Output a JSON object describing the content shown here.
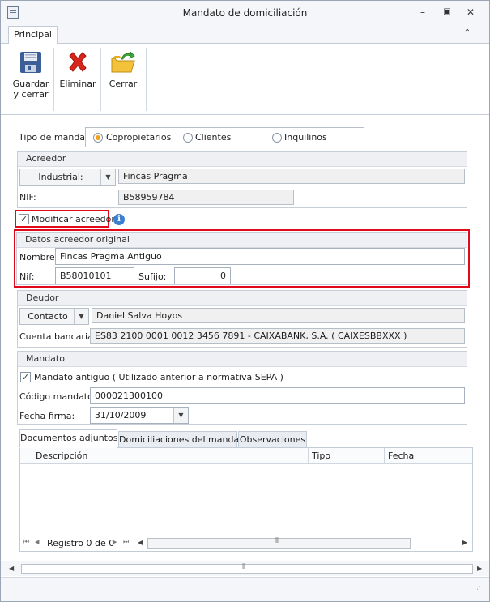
{
  "window": {
    "title": "Mandato de domiciliación",
    "min_glyph": "–",
    "max_glyph": "▣",
    "close_glyph": "✕"
  },
  "ribbon": {
    "tab": "Principal",
    "collapse_glyph": "⌃",
    "buttons": {
      "save_line1": "Guardar",
      "save_line2": "y cerrar",
      "delete": "Eliminar",
      "close": "Cerrar"
    }
  },
  "tipo_mandato": {
    "label": "Tipo de mandato:",
    "options": [
      "Copropietarios",
      "Clientes",
      "Inquilinos"
    ],
    "selected": "Copropietarios"
  },
  "acreedor": {
    "title": "Acreedor",
    "type": "Industrial:",
    "name": "Fincas Pragma",
    "nif_label": "NIF:",
    "nif": "B58959784"
  },
  "modificar": {
    "label": "Modificar acreedor",
    "checked": true,
    "info_glyph": "i"
  },
  "original": {
    "title": "Datos acreedor original",
    "nombre_label": "Nombre:",
    "nombre": "Fincas Pragma Antiguo",
    "nif_label": "Nif:",
    "nif": "B58010101",
    "sufijo_label": "Sufijo:",
    "sufijo": "0"
  },
  "deudor": {
    "title": "Deudor",
    "type": "Contacto",
    "name": "Daniel Salva Hoyos",
    "cuenta_label": "Cuenta bancaria:",
    "cuenta": "ES83 2100 0001 0012 3456 7891 - CAIXABANK, S.A. ( CAIXESBBXXX )"
  },
  "mandato": {
    "title": "Mandato",
    "antiguo_label": "Mandato antiguo ( Utilizado anterior a normativa SEPA )",
    "antiguo_checked": true,
    "codigo_label": "Código mandato:",
    "codigo": "000021300100",
    "fecha_label": "Fecha firma:",
    "fecha": "31/10/2009"
  },
  "tabs": [
    "Documentos adjuntos",
    "Domiciliaciones del mandato",
    "Observaciones"
  ],
  "grid": {
    "columns": [
      "Descripción",
      "Tipo",
      "Fecha"
    ],
    "rows": [],
    "record": "Registro 0 de 0",
    "nav_glyphs": [
      "⏮",
      "◀",
      "▶",
      "⏭"
    ]
  },
  "colors": {
    "highlight": "#e00a1b",
    "radio_selected": "#f2a118",
    "info": "#3a7fd0"
  }
}
